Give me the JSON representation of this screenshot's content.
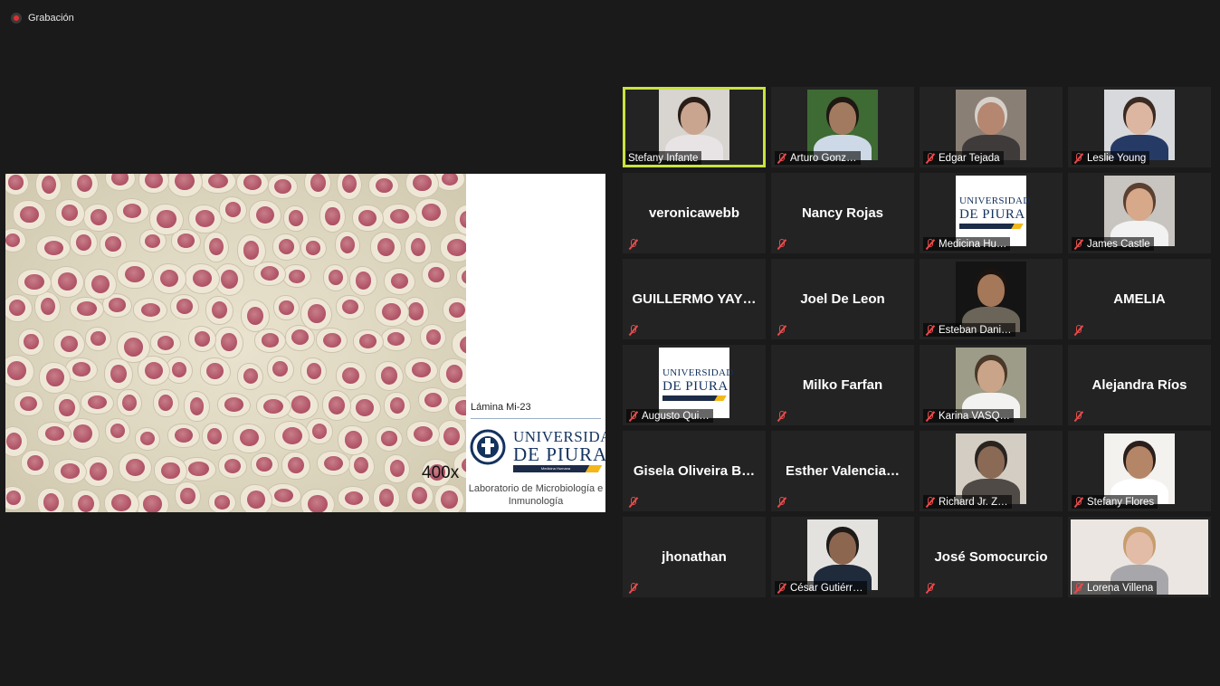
{
  "recording": {
    "label": "Grabación"
  },
  "share": {
    "magnification": "400x",
    "slide_title": "Lámina Mi-23",
    "logo_line1": "UNIVERSIDAD",
    "logo_line2": "DE PIURA",
    "logo_bar": "Medicina Humana",
    "lab_line1": "Laboratorio de Microbiología e",
    "lab_line2": "Inmunología"
  },
  "participants": [
    {
      "name": "Stefany Infante",
      "display": "photo",
      "active": true,
      "muted": false,
      "colors": [
        "#d8d4cf",
        "#2a1d18",
        "#c9a58f",
        "#e8e4e6"
      ]
    },
    {
      "name": "Arturo Gonz…",
      "display": "photo",
      "muted": true,
      "colors": [
        "#3e6a33",
        "#1e1712",
        "#a27a60",
        "#cdd9e6"
      ]
    },
    {
      "name": "Edgar Tejada",
      "display": "photo",
      "muted": true,
      "colors": [
        "#8a7f75",
        "#d6d0ca",
        "#b58670",
        "#3e3b3a"
      ]
    },
    {
      "name": "Leslie Young",
      "display": "photo",
      "muted": true,
      "colors": [
        "#d8d9dc",
        "#3b2a22",
        "#dcb6a0",
        "#263a66"
      ]
    },
    {
      "name": "veronicawebb",
      "display": "name",
      "muted": true
    },
    {
      "name": "Nancy Rojas",
      "display": "name",
      "muted": true
    },
    {
      "name": "Medicina Hu…",
      "display": "logo",
      "muted": true
    },
    {
      "name": "James Castle",
      "display": "photo",
      "muted": true,
      "colors": [
        "#c8c4c0",
        "#5a4030",
        "#d7a889",
        "#f2f2f2"
      ]
    },
    {
      "name": "GUILLERMO YAY…",
      "display": "name",
      "muted": true
    },
    {
      "name": "Joel De Leon",
      "display": "name",
      "muted": true
    },
    {
      "name": "Esteban Dani…",
      "display": "photo",
      "muted": true,
      "colors": [
        "#141414",
        "#1c1410",
        "#a5785a",
        "#6b6458"
      ]
    },
    {
      "name": "AMELIA",
      "display": "name",
      "muted": true,
      "noname_label": true
    },
    {
      "name": "Augusto Qui…",
      "display": "logo",
      "muted": true
    },
    {
      "name": "Milko Farfan",
      "display": "name",
      "muted": true
    },
    {
      "name": "Karina VASQ…",
      "display": "photo",
      "muted": true,
      "colors": [
        "#9c9c88",
        "#4a3828",
        "#caa488",
        "#f2f2f0"
      ]
    },
    {
      "name": "Alejandra Ríos",
      "display": "name",
      "muted": true,
      "noname_label": true
    },
    {
      "name": "Gisela Oliveira B…",
      "display": "name",
      "muted": true,
      "noname_label": true
    },
    {
      "name": "Esther  Valencia…",
      "display": "name",
      "muted": true,
      "noname_label": true
    },
    {
      "name": "Richard Jr. Z…",
      "display": "photo",
      "muted": true,
      "colors": [
        "#d3cdc4",
        "#2a2420",
        "#8a6a55",
        "#4f4a45"
      ]
    },
    {
      "name": "Stefany Flores",
      "display": "photo",
      "muted": true,
      "colors": [
        "#f4f2ef",
        "#2b1f1b",
        "#b48567",
        "#ffffff"
      ]
    },
    {
      "name": "jhonathan",
      "display": "name",
      "muted": true,
      "noname_label": true
    },
    {
      "name": "César Gutiérr…",
      "display": "photo",
      "muted": true,
      "colors": [
        "#e4e2de",
        "#1e1a17",
        "#8d6650",
        "#1f2a3b"
      ]
    },
    {
      "name": "José Somocurcio",
      "display": "name",
      "muted": true,
      "noname_label": true
    },
    {
      "name": "Lorena Villena",
      "display": "photo",
      "wide": true,
      "muted": true,
      "colors": [
        "#ece6e2",
        "#c79d6f",
        "#e2bca6",
        "#a7a7ab"
      ]
    }
  ]
}
